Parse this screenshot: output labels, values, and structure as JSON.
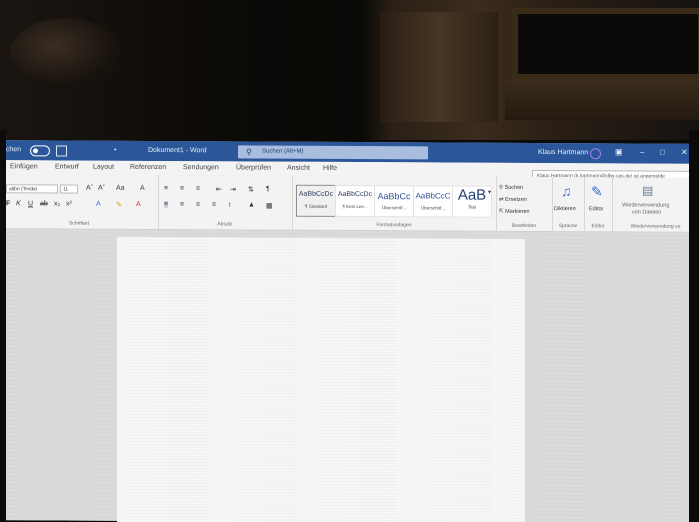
{
  "titlebar": {
    "autosave_label": "uchen",
    "title": "Dokument1 - Word",
    "search_placeholder": "Suchen (Alt+M)",
    "user_name": "Klaus Hartmann",
    "dot": "•"
  },
  "menu": {
    "tabs": [
      "Einfügen",
      "Entwurf",
      "Layout",
      "Referenzen",
      "Sendungen",
      "Überprüfen",
      "Ansicht",
      "Hilfe"
    ]
  },
  "tooltip": "Klaus Hartmann (k.hartmann@dbg-vas.de) ist angemelde",
  "ribbon": {
    "font_name": "alibri (Textkö",
    "font_size": "11",
    "groups": {
      "font": "Schriftart",
      "paragraph": "Absatz",
      "styles": "Formatvorlagen",
      "editing": "Bearbeiten",
      "voice": "Sprache",
      "editor": "Editor",
      "reuse": "Wiederverwendung vo"
    },
    "styles": [
      {
        "sample": "AaBbCcDc",
        "name": "¶ Standard"
      },
      {
        "sample": "AaBbCcDc",
        "name": "¶ Kein Lee..."
      },
      {
        "sample": "AaBbCc",
        "name": "Überschrif..."
      },
      {
        "sample": "AaBbCcC",
        "name": "Überschrif..."
      },
      {
        "sample": "AaB",
        "name": "Titel"
      }
    ],
    "editing": {
      "search": "Suchen",
      "replace": "Ersetzen",
      "select": "Markieren"
    },
    "dictate": "Diktieren",
    "editor": "Editor",
    "reuse_line1": "Wiederverwendung",
    "reuse_line2": "von Dateien"
  }
}
